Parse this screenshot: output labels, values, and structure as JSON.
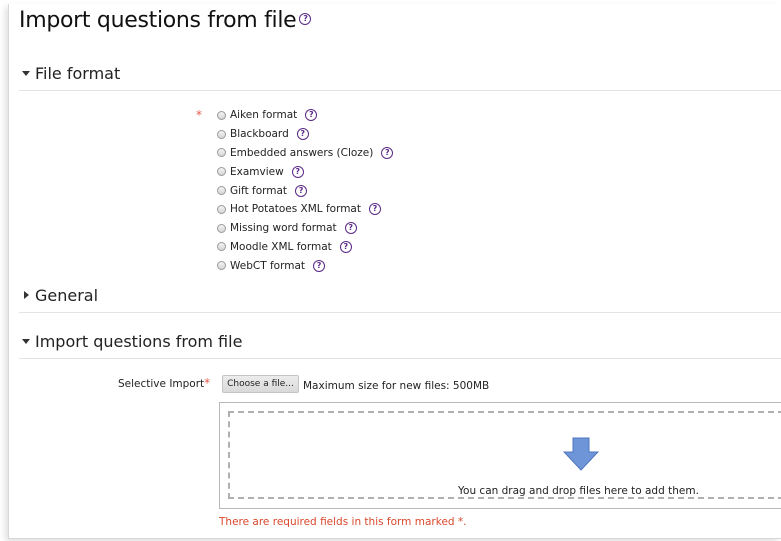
{
  "page": {
    "title": "Import questions from file",
    "title_help_icon": "help-icon"
  },
  "sections": {
    "file_format": "File format",
    "general": "General",
    "import": "Import questions from file"
  },
  "file_format": {
    "required_marker": "*",
    "options": [
      {
        "label": "Aiken format",
        "checked": false
      },
      {
        "label": "Blackboard",
        "checked": false
      },
      {
        "label": "Embedded answers (Cloze)",
        "checked": false
      },
      {
        "label": "Examview",
        "checked": false
      },
      {
        "label": "Gift format",
        "checked": false
      },
      {
        "label": "Hot Potatoes XML format",
        "checked": false
      },
      {
        "label": "Missing word format",
        "checked": false
      },
      {
        "label": "Moodle XML format",
        "checked": false
      },
      {
        "label": "WebCT format",
        "checked": false
      }
    ]
  },
  "import": {
    "field_label": "Selective Import",
    "required_marker": "*",
    "choose_button": "Choose a file...",
    "max_size": "Maximum size for new files: 500MB",
    "drop_text": "You can drag and drop files here to add them."
  },
  "footer": {
    "required_note": "There are required fields in this form marked",
    "required_marker": "*",
    "period": "."
  },
  "colors": {
    "help_icon": "#5b2a86",
    "required": "#e55a4a",
    "drop_arrow": "#6e95d8"
  }
}
